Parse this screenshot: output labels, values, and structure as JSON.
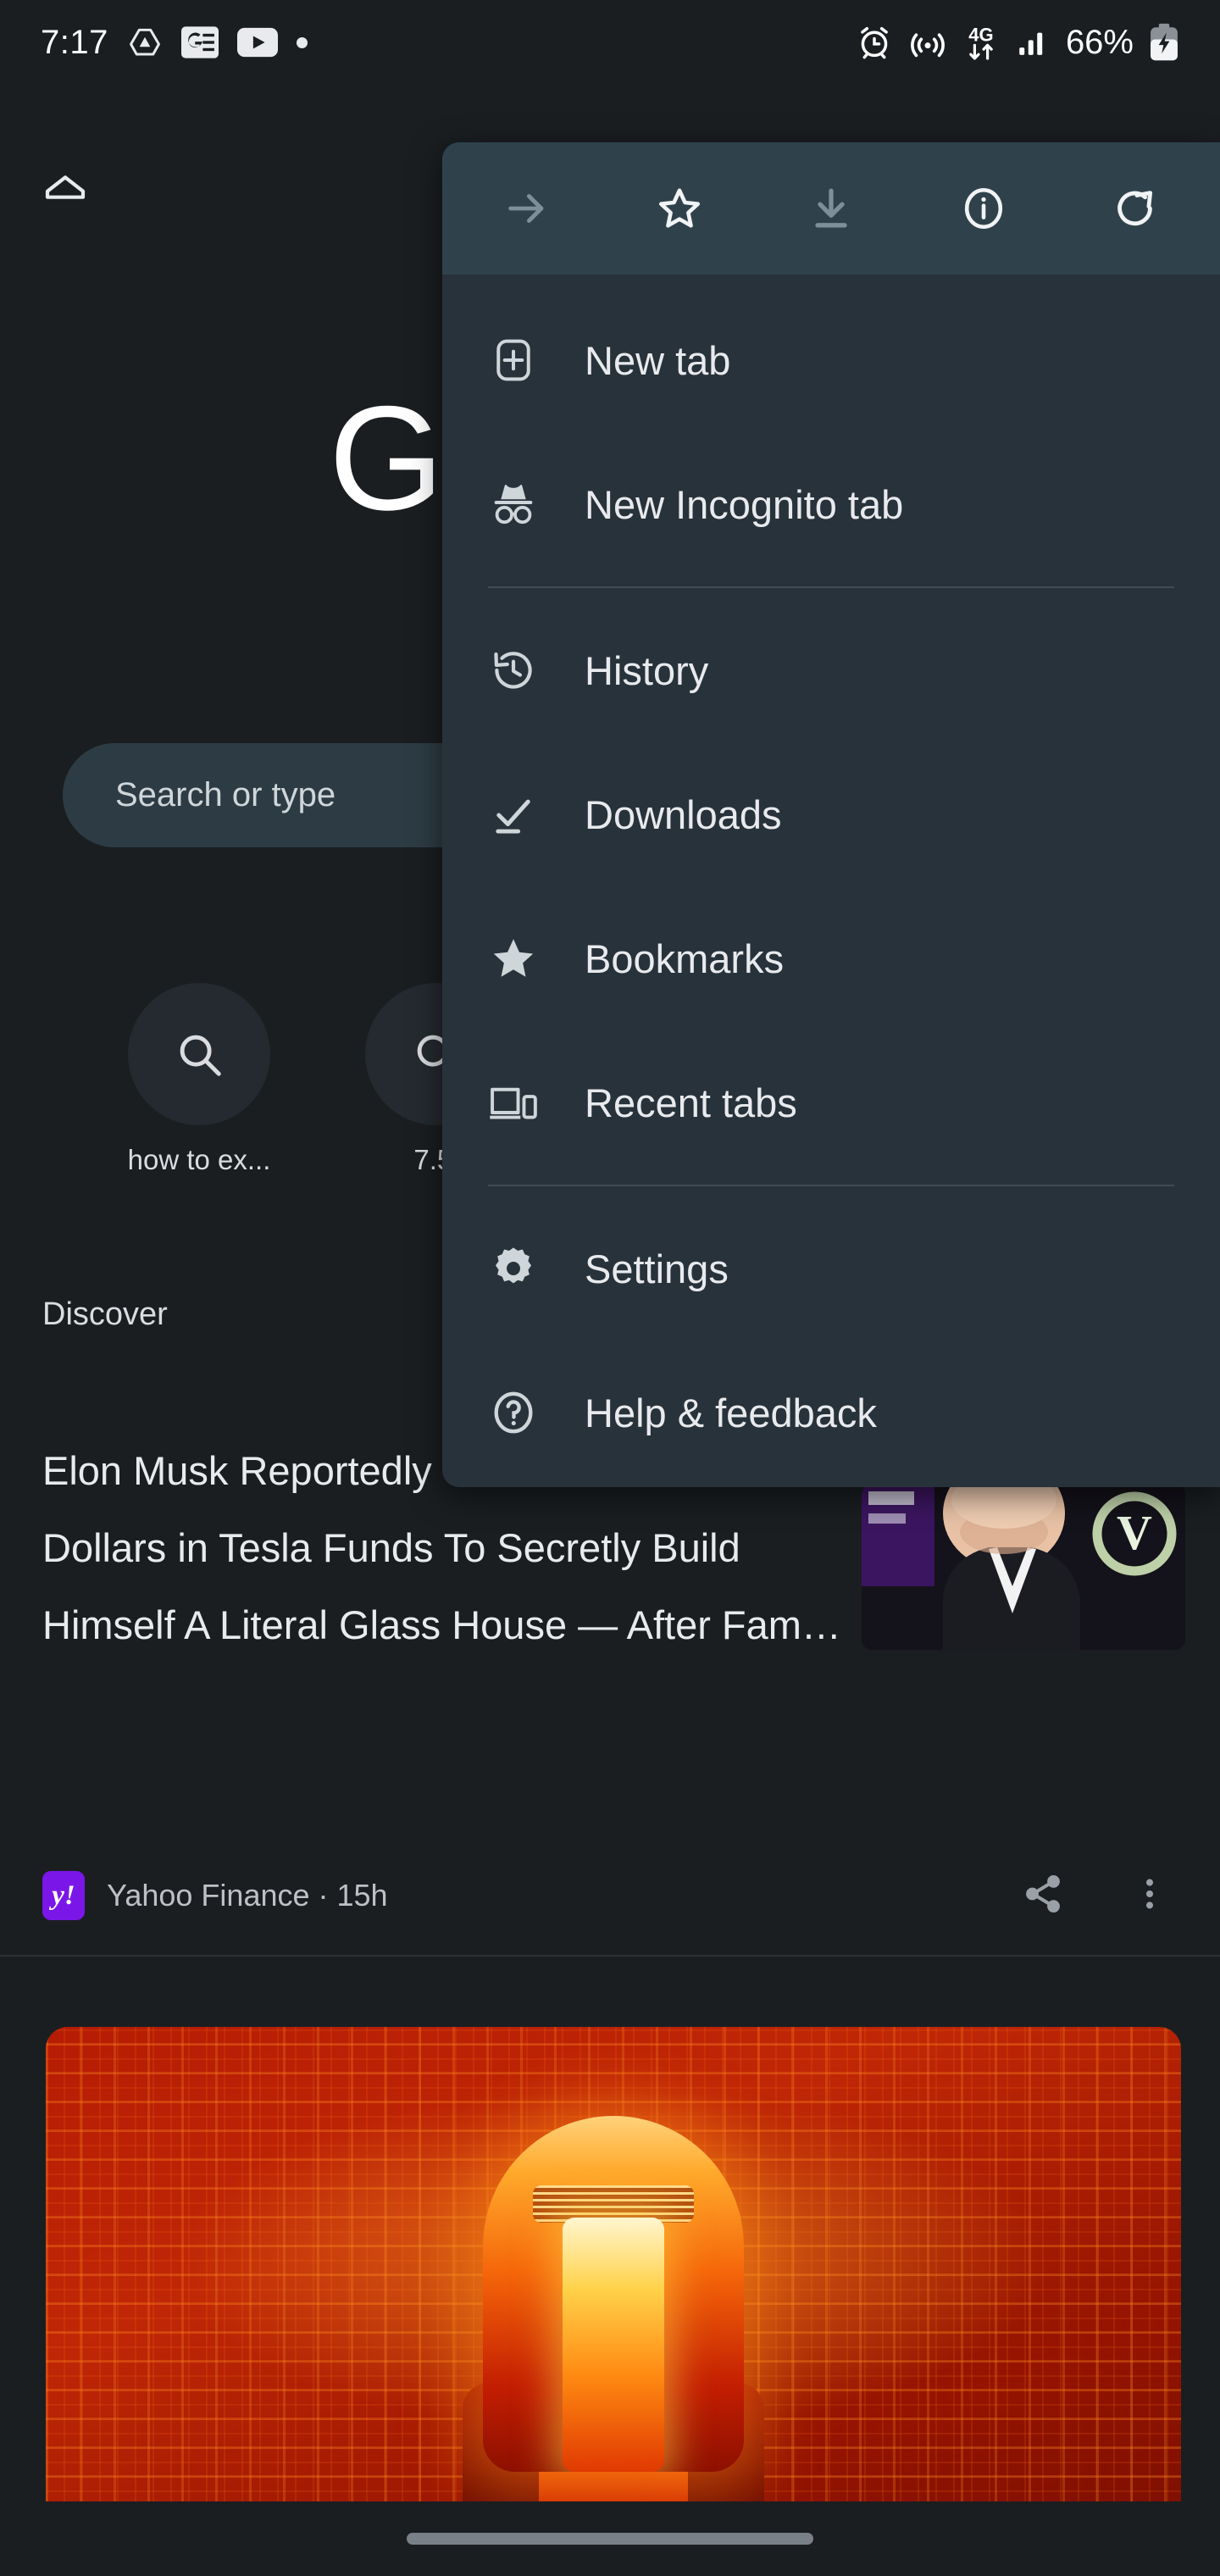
{
  "statusbar": {
    "time": "7:17",
    "left_icons": [
      {
        "name": "drive-icon",
        "label": "Google Drive"
      },
      {
        "name": "google-news-icon",
        "label": "Google News"
      },
      {
        "name": "youtube-icon",
        "label": "YouTube"
      },
      {
        "name": "dot-indicator-icon",
        "label": "More notifications"
      }
    ],
    "right_icons": [
      {
        "name": "alarm-icon",
        "label": "Alarm set"
      },
      {
        "name": "hotspot-icon",
        "label": "Hotspot"
      },
      {
        "name": "mobile-data-4g-icon",
        "label": "4G"
      },
      {
        "name": "signal-bars-icon",
        "label": "Signal"
      }
    ],
    "battery_percent": "66%",
    "battery_state": "charging"
  },
  "ntp": {
    "home_icon": "home-icon",
    "logo_text": "G",
    "omnibox": {
      "placeholder": "Search or type URL",
      "visible_text": "Search or type "
    },
    "tiles": [
      {
        "icon": "search-icon",
        "label": "how to ex..."
      },
      {
        "icon": "search-icon",
        "label": "7.5l"
      }
    ],
    "discover_header": "Discover"
  },
  "feed": {
    "articles": [
      {
        "headline": "Elon Musk Reportedly Used Millions of Dollars in Tesla Funds To Secretly Build Himself A Literal Glass House — After Fam…",
        "source": "Yahoo Finance",
        "source_badge": "y!",
        "time_ago": "15h",
        "separator": "·",
        "byline": "Yahoo Finance · 15h",
        "thumbnail_alt": "Elon Musk in a dark suit and white shirt",
        "actions": [
          {
            "name": "share-icon",
            "label": "Share"
          },
          {
            "name": "more-options-icon",
            "label": "More options"
          }
        ]
      },
      {
        "thumbnail_alt": "Glowing orange robot head on a circuit board background"
      }
    ]
  },
  "menu": {
    "toolbar": [
      {
        "name": "forward-icon",
        "label": "Forward",
        "enabled": false
      },
      {
        "name": "bookmark-star-icon",
        "label": "Bookmark",
        "enabled": true
      },
      {
        "name": "download-icon",
        "label": "Download page",
        "enabled": false
      },
      {
        "name": "page-info-icon",
        "label": "Page info",
        "enabled": true
      },
      {
        "name": "reload-icon",
        "label": "Reload",
        "enabled": true
      }
    ],
    "groups": [
      {
        "items": [
          {
            "icon": "new-tab-icon",
            "label": "New tab"
          },
          {
            "icon": "incognito-icon",
            "label": "New Incognito tab"
          }
        ]
      },
      {
        "items": [
          {
            "icon": "history-icon",
            "label": "History"
          },
          {
            "icon": "downloads-icon",
            "label": "Downloads"
          },
          {
            "icon": "bookmarks-star-icon",
            "label": "Bookmarks"
          },
          {
            "icon": "recent-tabs-icon",
            "label": "Recent tabs"
          }
        ]
      },
      {
        "items": [
          {
            "icon": "settings-gear-icon",
            "label": "Settings"
          },
          {
            "icon": "help-circle-icon",
            "label": "Help & feedback"
          }
        ]
      }
    ]
  },
  "colors": {
    "page_background": "#1a1e21",
    "menu_background": "#28323a",
    "menu_toolbar_background": "#2f424c",
    "omnibox_background": "#2d3c44",
    "text_primary": "#e8eaed",
    "text_secondary": "#bdc1c6",
    "yahoo_purple": "#7b16e8",
    "nav_pill": "#7a8087"
  }
}
